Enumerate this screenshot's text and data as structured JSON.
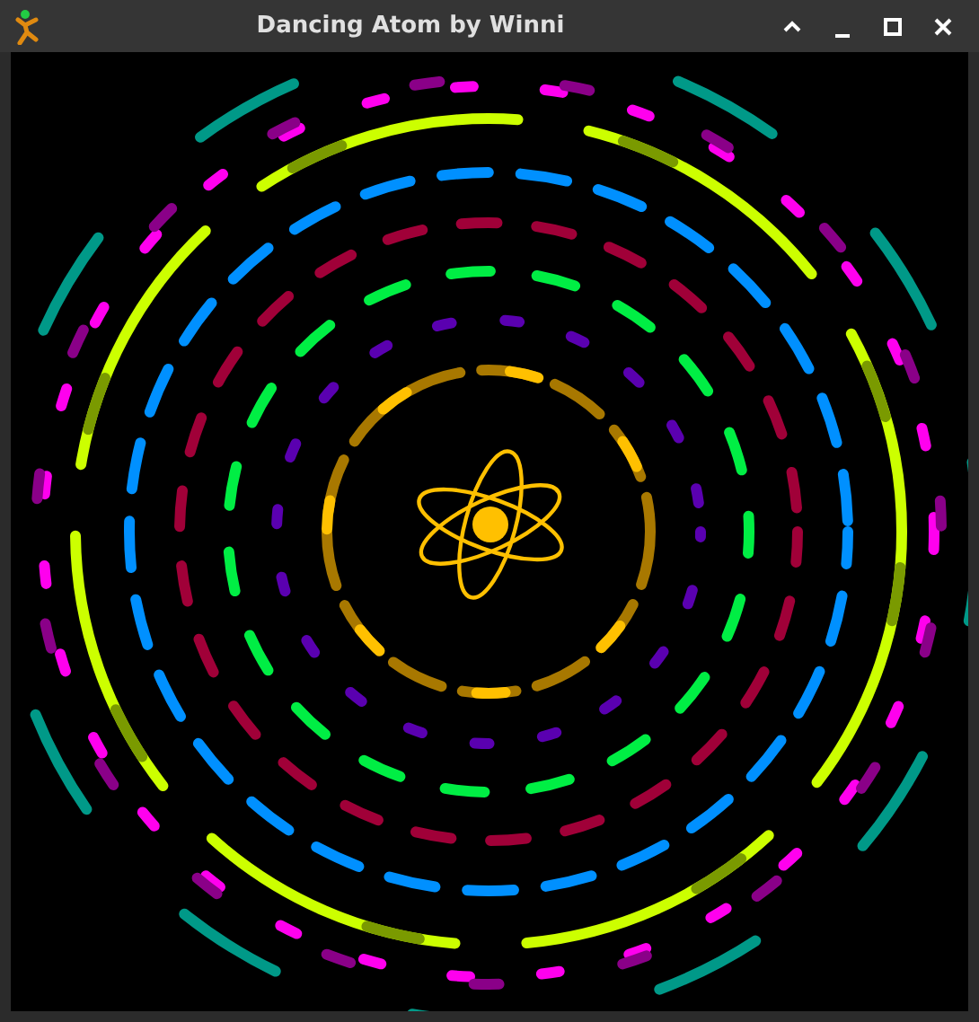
{
  "window": {
    "title": "Dancing Atom by Winni"
  }
}
